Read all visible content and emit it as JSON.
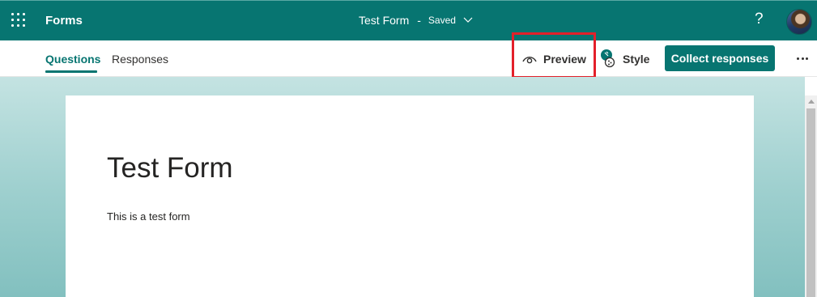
{
  "header": {
    "app_name": "Forms",
    "form_title": "Test Form",
    "separator": "-",
    "status": "Saved",
    "help": "?",
    "icons": [
      "app-launcher-icon",
      "chevron-down-icon",
      "help-icon",
      "avatar"
    ]
  },
  "tabs": [
    {
      "label": "Questions",
      "active": true
    },
    {
      "label": "Responses",
      "active": false
    }
  ],
  "toolbar": {
    "preview_label": "Preview",
    "style_label": "Style",
    "collect_label": "Collect responses",
    "icons": [
      "eye-icon",
      "palette-icon",
      "more-icon"
    ]
  },
  "form": {
    "title": "Test Form",
    "description": "This is a test form"
  },
  "colors": {
    "brand": "#077571",
    "highlight": "#e3202a",
    "background_gradient": [
      "#c4e3e2",
      "#82c0bf"
    ]
  }
}
